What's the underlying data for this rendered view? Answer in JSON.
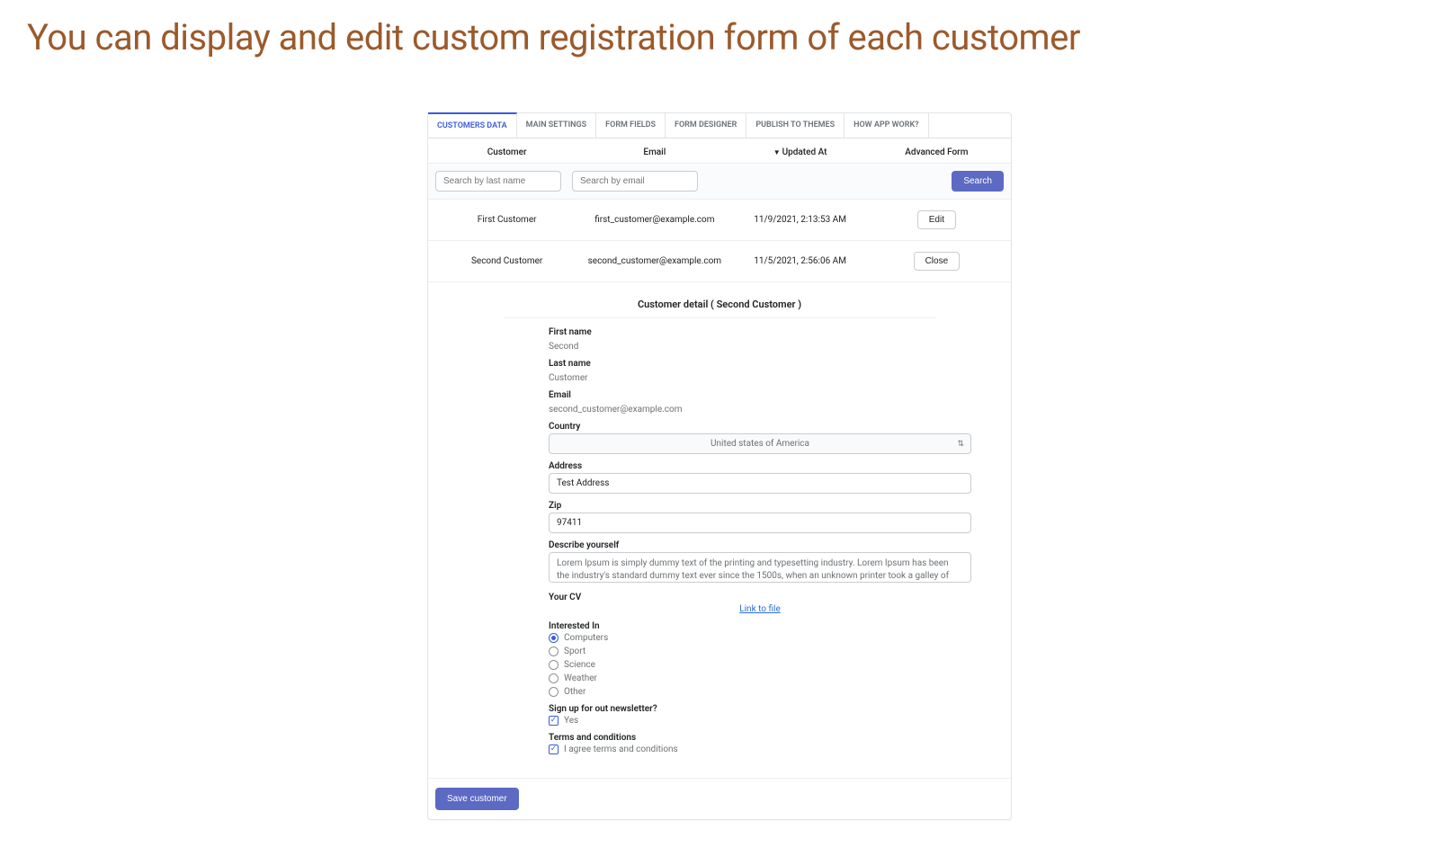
{
  "page": {
    "title": "You can display and edit custom registration form of each customer"
  },
  "tabs": {
    "items": [
      {
        "label": "CUSTOMERS DATA",
        "active": true
      },
      {
        "label": "MAIN SETTINGS",
        "active": false
      },
      {
        "label": "FORM FIELDS",
        "active": false
      },
      {
        "label": "FORM DESIGNER",
        "active": false
      },
      {
        "label": "PUBLISH TO THEMES",
        "active": false
      },
      {
        "label": "HOW APP WORK?",
        "active": false
      }
    ]
  },
  "table": {
    "columns": {
      "customer": "Customer",
      "email": "Email",
      "updated_at": "Updated At",
      "advanced_form": "Advanced Form"
    },
    "search": {
      "lastname_placeholder": "Search by last name",
      "email_placeholder": "Search by email",
      "button": "Search"
    },
    "rows": [
      {
        "customer": "First Customer",
        "email": "first_customer@example.com",
        "updated_at": "11/9/2021, 2:13:53 AM",
        "action_label": "Edit"
      },
      {
        "customer": "Second Customer",
        "email": "second_customer@example.com",
        "updated_at": "11/5/2021, 2:56:06 AM",
        "action_label": "Close"
      }
    ]
  },
  "detail": {
    "title": "Customer detail ( Second Customer )",
    "first_name": {
      "label": "First name",
      "value": "Second"
    },
    "last_name": {
      "label": "Last name",
      "value": "Customer"
    },
    "email": {
      "label": "Email",
      "value": "second_customer@example.com"
    },
    "country": {
      "label": "Country",
      "value": "United states of America"
    },
    "address": {
      "label": "Address",
      "value": "Test Address"
    },
    "zip": {
      "label": "Zip",
      "value": "97411"
    },
    "describe": {
      "label": "Describe yourself",
      "value": "Lorem Ipsum is simply dummy text of the printing and typesetting industry. Lorem Ipsum has been the industry's standard dummy text ever since the 1500s, when an unknown printer took a galley of type and"
    },
    "cv": {
      "label": "Your CV",
      "link_text": "Link to file"
    },
    "interested": {
      "label": "Interested In",
      "options": [
        {
          "label": "Computers",
          "checked": true
        },
        {
          "label": "Sport",
          "checked": false
        },
        {
          "label": "Science",
          "checked": false
        },
        {
          "label": "Weather",
          "checked": false
        },
        {
          "label": "Other",
          "checked": false
        }
      ]
    },
    "newsletter": {
      "label": "Sign up for out newsletter?",
      "option_label": "Yes",
      "checked": true
    },
    "terms": {
      "label": "Terms and conditions",
      "option_label": "I agree terms and conditions",
      "checked": true
    },
    "save_button": "Save customer"
  }
}
